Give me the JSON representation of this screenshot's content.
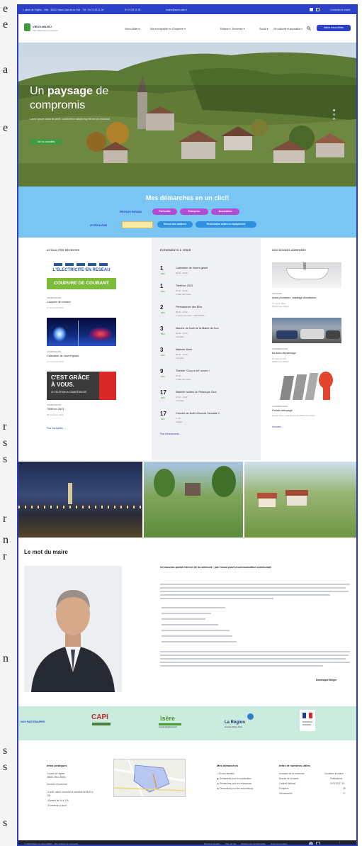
{
  "edge_text": [
    "e",
    "e",
    "a",
    "e",
    "r",
    "s",
    "s",
    "r",
    "n",
    "r",
    "n",
    "s",
    "s",
    "s"
  ],
  "topbar": {
    "address": "1 place de l'église - Ville - 38110 Saint-Clair-de-la-Tour - Tél : 04 74 83 11 30",
    "phone": "04 74 83 11 30",
    "email": "mairie@saint-clair.fr",
    "link_right": "Contacter la mairie"
  },
  "header": {
    "logo_name": "VIEUX-MILIEU",
    "logo_sub": "Site officiel de la commune",
    "nav": [
      "Vieux-Milieu ▾",
      "Ma municipalité en Citoyenne ▾",
      "Enfance / Jeunesse ▾",
      "Social ▾",
      "Vie culturelle et associative ▾"
    ],
    "portal_button": "Mairie Vieux-Milieu"
  },
  "hero": {
    "title_plain": "Un",
    "title_bold": "paysage",
    "title_rest": "de",
    "title_line2": "compromis",
    "subtitle": "Lorem ipsum dolor sit amet, consectetur adipiscing elit sed do eiusmod",
    "button": "Voir les actualités"
  },
  "demarches": {
    "title": "Mes démarches en un clic!!",
    "profile_label": "PROFILÉS RAPIDES",
    "pills": [
      "Particulier",
      "Entreprise",
      "Association"
    ],
    "access_label": "ACCÈS RAPIDE",
    "services_button": "Menus des cantines",
    "reserve_button": "Réservation salles ou équipement"
  },
  "news": {
    "heading": "ACTUALITÉS RÉCENTES",
    "img1_top": "L'ELECTRICITE EN RESEAU",
    "img1_bottom": "COUPURE DE COURANT",
    "img3_line1": "C'EST GRÂCE",
    "img3_line2": "À VOUS.",
    "img3_line3": "LE TÉLÉTHON A CHANGÉ MA VIE",
    "items": [
      {
        "cat": "COMMUNAUTÉ",
        "title": "Coupure de courant",
        "date": "21 novembre 2023"
      },
      {
        "cat": "COMMUNAUTÉ",
        "title": "Calendrier de l'avent géant",
        "date": "21 novembre 2023"
      },
      {
        "cat": "COMMUNAUTÉ",
        "title": "Téléthon 2023",
        "date": "20 novembre 2023"
      }
    ],
    "more": "Plus d'actualités  →"
  },
  "events": {
    "heading": "ÉVÉNEMENTS À VENIR",
    "items": [
      {
        "day": "1",
        "month": "DÉC",
        "title": "Calendrier de l'avent géant",
        "meta1": "18:00 - 19:00",
        "meta2": ""
      },
      {
        "day": "1",
        "month": "DÉC",
        "title": "Téléthon 2023",
        "meta1": "18:00 - 23:00",
        "meta2": "L'Salle des Fêtes"
      },
      {
        "day": "2",
        "month": "DÉC",
        "title": "Permanence des Élus",
        "meta1": "09:00 - 12:00",
        "meta2": "L'Centre de Loisirs • 284 ADMIN •"
      },
      {
        "day": "3",
        "month": "DÉC",
        "title": "Marché de Noël de la Mairie du Sou",
        "meta1": "10:00 - 13:00",
        "meta2": "L'la Halle"
      },
      {
        "day": "3",
        "month": "DÉC",
        "title": "Matinée Diots",
        "meta1": "09:00 - 12:00",
        "meta2": "L'la Halle"
      },
      {
        "day": "9",
        "month": "DÉC",
        "title": "Théâtre \"Coco à toi\" ouvert !",
        "meta1": "20:30",
        "meta2": "L'Salle des Fêtes"
      },
      {
        "day": "17",
        "month": "DÉC",
        "title": "Matinée huîtres du Pétanque Club",
        "meta1": "10:00 - 14:00",
        "meta2": "L'la Halle"
      },
      {
        "day": "17",
        "month": "DÉC",
        "title": "Concert de Noël d'Accord Sensible !!",
        "meta1": "17:00",
        "meta2": "L'Église"
      }
    ],
    "more": "Plus d'événements  →"
  },
  "addresses": {
    "heading": "NOS BONNES ADRESSES",
    "items": [
      {
        "cat": "ARTISANS",
        "title": "Action plomberie / chauffage climatisation",
        "addr1": "77 rue du Tilleul",
        "addr2": "38460 Vieux-Milieu"
      },
      {
        "cat": "COMMERÇANTS",
        "title": "B4 Auto-dépannage",
        "addr1": "87 route du Port",
        "addr2": "38460 Vieux-Milieu"
      },
      {
        "cat": "COMMERÇANTS",
        "title": "Parfait nettoyage",
        "addr1": "Rue de l'Usine, Zone de la Craze 38460 Vieux-Milieu",
        "addr2": ""
      }
    ],
    "more": "Annuaire  →"
  },
  "maire": {
    "title": "Le mot du maire",
    "headline": "Un nouveau portail internet de la commune : pari réussi pour la communication communale",
    "signature": "Dominique Berger"
  },
  "partners": {
    "label": "NOS PARTENAIRES",
    "capi": "CAPI",
    "isere": "isère",
    "isere_sub": "conseil départemental",
    "region": "La Région",
    "region_sub": "Auvergne-Rhône-Alpes"
  },
  "footer": {
    "info_heading": "Infos pratiques",
    "info_lines": [
      "1 place de l'église",
      "38460 Vieux-Milieu"
    ],
    "hours_label": "Horaires d'ouverture",
    "hours_lines": [
      "• Lundi, mardi, mercredi et vendredi de 8h30 à",
      "  12h",
      "• Samedi de 9h à 12h",
      "• Fermeture le jeudi"
    ],
    "dem_heading": "Mes démarches",
    "dem_items": [
      "En tout familles",
      "Démarches pour les particuliers",
      "Démarches pour les entreprises",
      "Démarches pour les associations"
    ],
    "util_heading": "Infos et numéros utiles",
    "util_rows": [
      {
        "label": "Annuaire de la commune",
        "value": "Contacter la mairie"
      },
      {
        "label": "Bourse de la mairie",
        "value": "Publications"
      },
      {
        "label": "Cabinet Médical",
        "value": "0474 83 27 10"
      },
      {
        "label": "Pompiers",
        "value": "18"
      },
      {
        "label": "Gendarmerie",
        "value": "17"
      }
    ],
    "bar_copy": "© 2023 Mairie de Vieux-Milieu · Site réalisé par Lisonsatz",
    "bar_links": [
      "Mentions légales",
      "Plan du site",
      "Politique de confidentialité",
      "Gérer les cookies"
    ]
  }
}
